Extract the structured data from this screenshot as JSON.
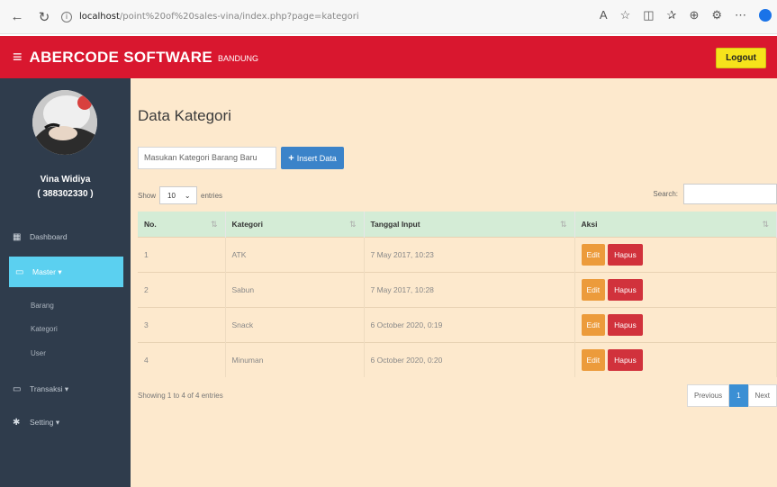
{
  "browser": {
    "url_host": "localhost",
    "url_path": "/point%20of%20sales-vina/index.php?page=kategori"
  },
  "header": {
    "brand": "ABERCODE SOFTWARE",
    "brand_sub": "BANDUNG",
    "logout": "Logout"
  },
  "sidebar": {
    "user_name": "Vina Widiya",
    "user_id": "( 388302330 )",
    "dashboard": "Dashboard",
    "master": "Master ▾",
    "master_items": [
      "Barang",
      "Kategori",
      "User"
    ],
    "transaksi": "Transaksi ▾",
    "setting": "Setting ▾"
  },
  "main": {
    "title": "Data Kategori",
    "input_placeholder": "Masukan Kategori Barang Baru",
    "insert_label": "Insert Data",
    "show_label": "Show",
    "show_value": "10",
    "entries_label": "entries",
    "search_label": "Search:",
    "columns": [
      "No.",
      "Kategori",
      "Tanggal Input",
      "Aksi"
    ],
    "rows": [
      {
        "no": "1",
        "kategori": "ATK",
        "tanggal": "7 May 2017, 10:23"
      },
      {
        "no": "2",
        "kategori": "Sabun",
        "tanggal": "7 May 2017, 10:28"
      },
      {
        "no": "3",
        "kategori": "Snack",
        "tanggal": "6 October 2020, 0:19"
      },
      {
        "no": "4",
        "kategori": "Minuman",
        "tanggal": "6 October 2020, 0:20"
      }
    ],
    "edit_label": "Edit",
    "hapus_label": "Hapus",
    "showing": "Showing 1 to 4 of 4 entries",
    "pager": {
      "prev": "Previous",
      "current": "1",
      "next": "Next"
    }
  },
  "colors": {
    "header_red": "#d9172f",
    "sidebar_dark": "#2f3c4c",
    "active_cyan": "#5bd0f0",
    "content_bg": "#fde9cd",
    "insert_blue": "#3b83c9",
    "edit_orange": "#ec9b3b",
    "hapus_red": "#d1323c",
    "logout_yellow": "#f6e31b"
  }
}
